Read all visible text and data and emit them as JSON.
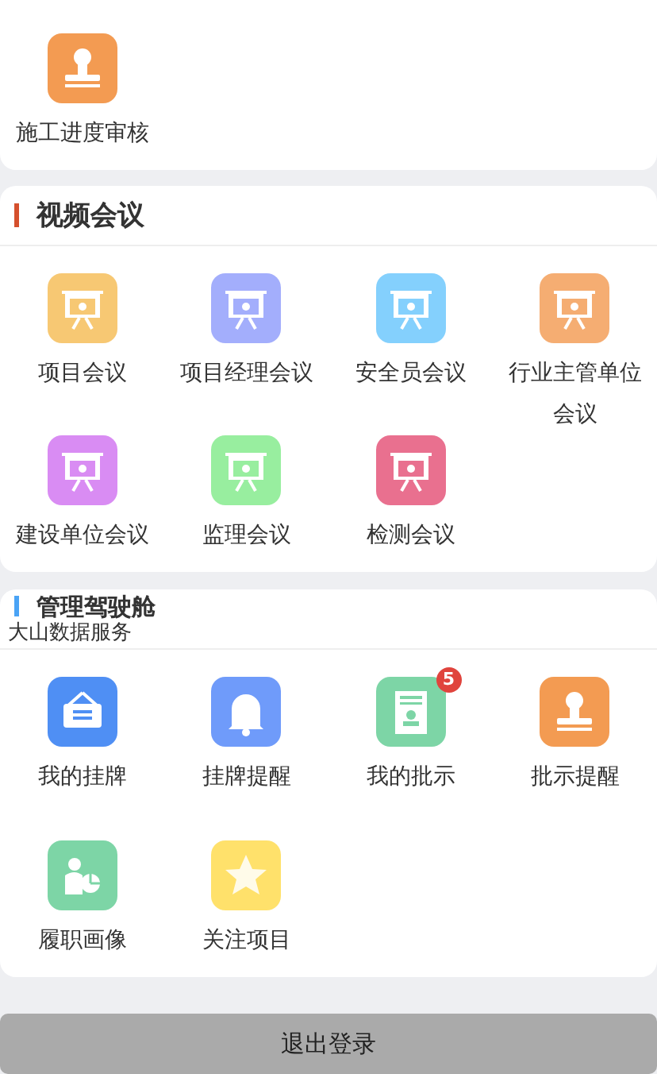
{
  "top_section": {
    "items": [
      {
        "label": "施工进度审核",
        "kind": "stamp",
        "color": "#f39b52"
      }
    ]
  },
  "sections": [
    {
      "title": "视频会议",
      "color": "#d5502d",
      "items": [
        {
          "label": "项目会议",
          "kind": "board",
          "color": "#f7c873"
        },
        {
          "label": "项目经理会议",
          "kind": "board",
          "color": "#a3aefc"
        },
        {
          "label": "安全员会议",
          "kind": "board",
          "color": "#84d0fd"
        },
        {
          "label": "行业主管单位会议",
          "kind": "board",
          "color": "#f5ad72"
        },
        {
          "label": "建设单位会议",
          "kind": "board",
          "color": "#d98cf3"
        },
        {
          "label": "监理会议",
          "kind": "board",
          "color": "#98ee9f"
        },
        {
          "label": "检测会议",
          "kind": "board",
          "color": "#e9708f"
        }
      ]
    },
    {
      "title": "管理驾驶舱",
      "color": "#4aa3f5",
      "overlay_text": "大山数据服务",
      "items": [
        {
          "label": "我的挂牌",
          "kind": "signboard",
          "color": "#4f8ff4"
        },
        {
          "label": "挂牌提醒",
          "kind": "bell",
          "color": "#6f9bfa"
        },
        {
          "label": "我的批示",
          "kind": "certificate",
          "color": "#7dd5a6",
          "badge": "5"
        },
        {
          "label": "批示提醒",
          "kind": "stamp",
          "color": "#f39b52"
        },
        {
          "label": "履职画像",
          "kind": "profile",
          "color": "#7dd5a6"
        },
        {
          "label": "关注项目",
          "kind": "star",
          "color": "#ffe16b"
        }
      ]
    }
  ],
  "logout_button": "退出登录"
}
